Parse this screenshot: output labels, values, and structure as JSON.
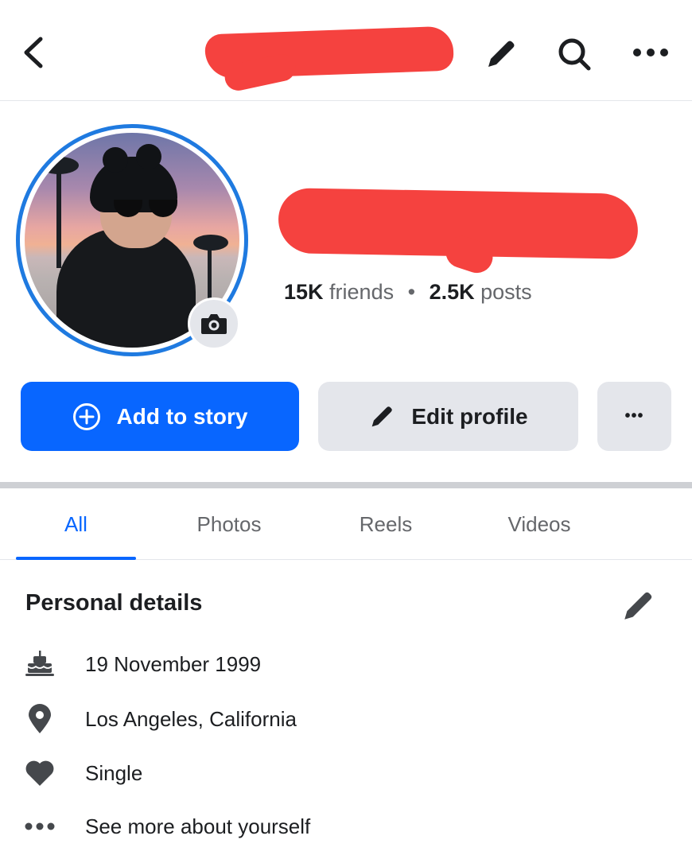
{
  "header": {
    "back_icon": "chevron-left-icon",
    "edit_icon": "pencil-icon",
    "search_icon": "search-icon",
    "more_icon": "more-horizontal-icon"
  },
  "profile": {
    "friends_count": "15K",
    "friends_label": "friends",
    "separator": "•",
    "posts_count": "2.5K",
    "posts_label": "posts",
    "camera_icon": "camera-icon"
  },
  "actions": {
    "add_story_label": "Add to story",
    "edit_profile_label": "Edit profile",
    "more_label": "•••",
    "accent_color": "#0866ff"
  },
  "tabs": [
    {
      "label": "All",
      "active": true
    },
    {
      "label": "Photos",
      "active": false
    },
    {
      "label": "Reels",
      "active": false
    },
    {
      "label": "Videos",
      "active": false
    }
  ],
  "personal_details": {
    "title": "Personal details",
    "items": [
      {
        "icon": "birthday-cake-icon",
        "text": "19 November 1999"
      },
      {
        "icon": "location-pin-icon",
        "text": "Los Angeles, California"
      },
      {
        "icon": "heart-icon",
        "text": "Single"
      },
      {
        "icon": "more-horizontal-icon",
        "text": "See more about yourself"
      }
    ]
  }
}
